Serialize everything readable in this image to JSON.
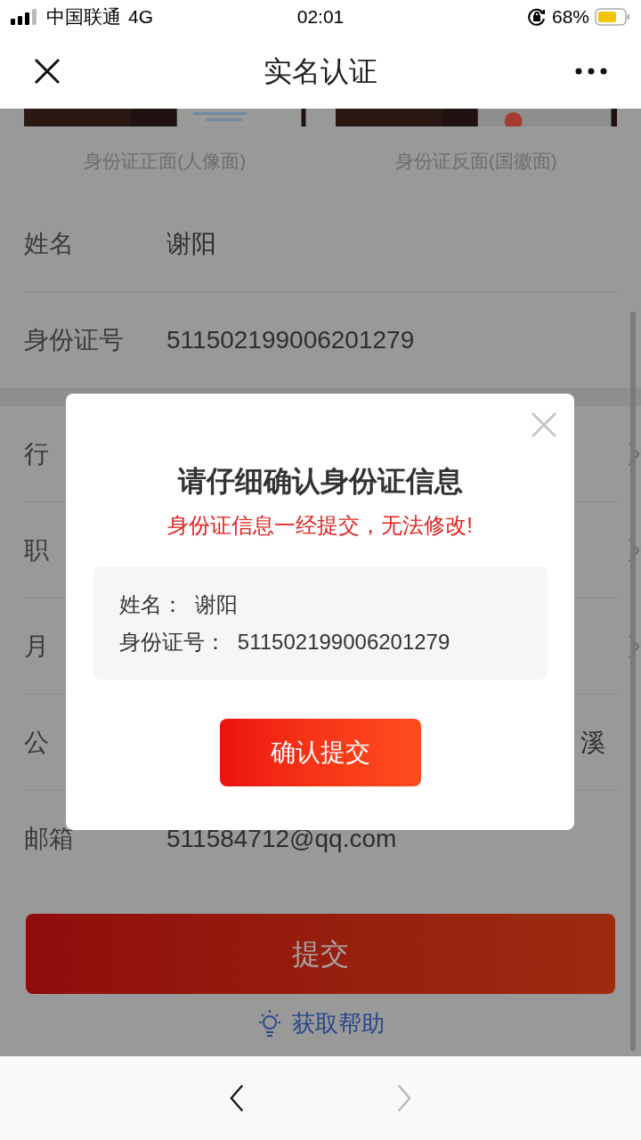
{
  "status_bar": {
    "carrier": "中国联通",
    "network": "4G",
    "time": "02:01",
    "battery": "68%"
  },
  "nav": {
    "title": "实名认证"
  },
  "photos": [
    {
      "kind": "picture",
      "caption": "身份证正面(人像面)"
    },
    {
      "kind": "picture",
      "caption": "身份证反面(国徽面)"
    }
  ],
  "form": {
    "rows": [
      {
        "kind": "text",
        "label": "姓名",
        "value": "谢阳"
      },
      {
        "kind": "text",
        "label": "身份证号",
        "value": "511502199006201279"
      }
    ]
  },
  "form2": {
    "rows": [
      {
        "kind": "select",
        "label": "行"
      },
      {
        "kind": "select",
        "label": "职"
      },
      {
        "kind": "select",
        "label": "月"
      },
      {
        "kind": "text",
        "label": "公",
        "value": "溪"
      },
      {
        "kind": "text",
        "label": "邮箱",
        "value": "511584712@qq.com"
      }
    ]
  },
  "submit_button": "提交",
  "help_link": "获取帮助",
  "dialog": {
    "title": "请仔细确认身份证信息",
    "warning": "身份证信息一经提交，无法修改!",
    "lines": [
      "姓名：  谢阳",
      "身份证号：  511502199006201279"
    ],
    "confirm_button": "确认提交"
  },
  "browser_bar": {
    "back_disabled": false,
    "forward_disabled": true
  }
}
